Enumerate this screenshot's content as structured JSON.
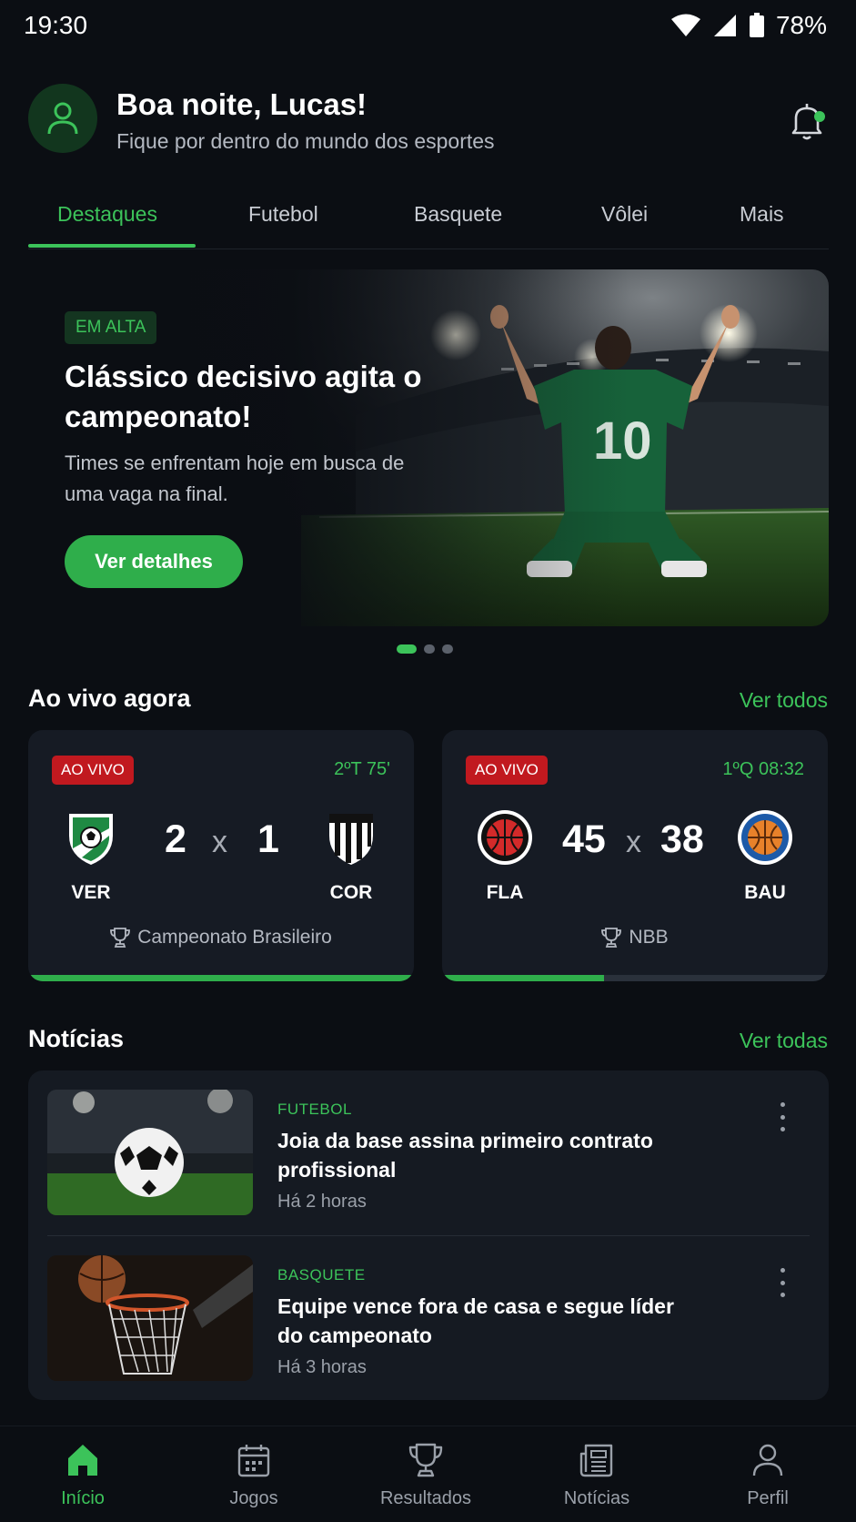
{
  "status_bar": {
    "time": "19:30",
    "battery": "78%"
  },
  "header": {
    "greeting": "Boa noite, Lucas!",
    "subtitle": "Fique por dentro do mundo dos esportes"
  },
  "tabs": [
    {
      "label": "Destaques",
      "active": true
    },
    {
      "label": "Futebol"
    },
    {
      "label": "Basquete"
    },
    {
      "label": "Vôlei"
    },
    {
      "label": "Mais"
    }
  ],
  "hero": {
    "tag": "EM ALTA",
    "title": "Clássico decisivo agita o campeonato!",
    "description": "Times se enfrentam hoje em busca de uma vaga na final.",
    "button": "Ver detalhes",
    "jersey_number": "10",
    "slide_count": 3,
    "active_slide": 1
  },
  "live": {
    "title": "Ao vivo agora",
    "link": "Ver todos",
    "matches": [
      {
        "badge": "AO VIVO",
        "time": "2ºT 75'",
        "home": "VER",
        "away": "COR",
        "home_score": "2",
        "away_score": "1",
        "separator": "x",
        "league": "Campeonato Brasileiro",
        "progress": 1.0
      },
      {
        "badge": "AO VIVO",
        "time": "1ºQ 08:32",
        "home": "FLA",
        "away": "BAU",
        "home_score": "45",
        "away_score": "38",
        "separator": "x",
        "league": "NBB",
        "progress": 0.42
      }
    ]
  },
  "news": {
    "title": "Notícias",
    "link": "Ver todas",
    "items": [
      {
        "category": "FUTEBOL",
        "title": "Joia da base assina primeiro contrato profissional",
        "time": "Há 2 horas"
      },
      {
        "category": "BASQUETE",
        "title": "Equipe vence fora de casa e segue líder do campeonato",
        "time": "Há 3 horas"
      }
    ]
  },
  "bottom_nav": [
    {
      "label": "Início",
      "icon": "home-icon",
      "active": true
    },
    {
      "label": "Jogos",
      "icon": "calendar-icon"
    },
    {
      "label": "Resultados",
      "icon": "trophy-icon"
    },
    {
      "label": "Notícias",
      "icon": "newspaper-icon"
    },
    {
      "label": "Perfil",
      "icon": "user-icon"
    }
  ],
  "colors": {
    "accent": "#3cc35a",
    "live_badge": "#c1191f",
    "background": "#0b0e13",
    "card": "#161b24"
  }
}
